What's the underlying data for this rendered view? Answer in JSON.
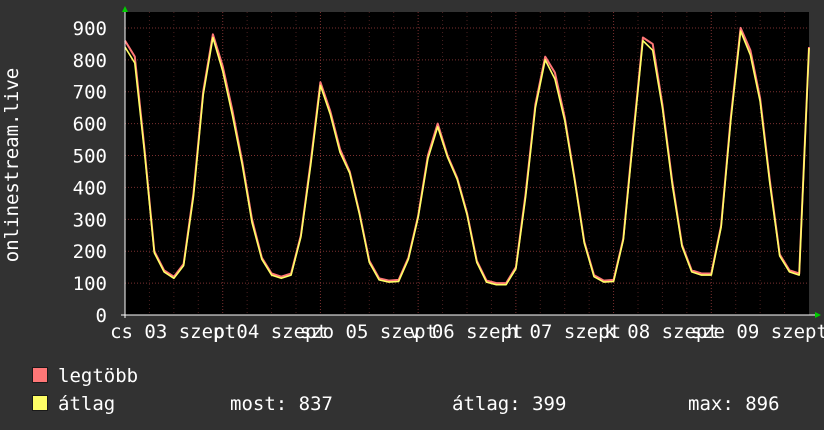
{
  "chart_data": {
    "type": "area",
    "ylabel": "onlinestream.live",
    "ylim": [
      0,
      950
    ],
    "y_ticks": [
      0,
      100,
      200,
      300,
      400,
      500,
      600,
      700,
      800,
      900
    ],
    "x_tick_labels": [
      "cs 03 szept",
      "p 04 szept",
      "szo 05 szept",
      "v 06 szept",
      "h 07 szept",
      "k 08 szept",
      "sze 09 szept"
    ],
    "grid": true,
    "series": [
      {
        "name": "legtöbb",
        "color": "#ff7777",
        "x": [
          0,
          0.1,
          0.2,
          0.3,
          0.4,
          0.5,
          0.6,
          0.7,
          0.8,
          0.9,
          1,
          1.1,
          1.2,
          1.3,
          1.4,
          1.5,
          1.6,
          1.7,
          1.8,
          1.9,
          2,
          2.1,
          2.2,
          2.3,
          2.4,
          2.5,
          2.6,
          2.7,
          2.8,
          2.9,
          3,
          3.1,
          3.2,
          3.3,
          3.4,
          3.5,
          3.6,
          3.7,
          3.8,
          3.9,
          4,
          4.1,
          4.2,
          4.3,
          4.4,
          4.5,
          4.6,
          4.7,
          4.8,
          4.9,
          5,
          5.1,
          5.2,
          5.3,
          5.4,
          5.5,
          5.6,
          5.7,
          5.8,
          5.9,
          6,
          6.1,
          6.2,
          6.3,
          6.4,
          6.5,
          6.6,
          6.7,
          6.8,
          6.9,
          7
        ],
        "values": [
          860,
          810,
          520,
          200,
          140,
          120,
          160,
          380,
          700,
          880,
          780,
          640,
          480,
          300,
          180,
          130,
          120,
          130,
          250,
          480,
          730,
          640,
          520,
          450,
          320,
          170,
          115,
          108,
          110,
          180,
          310,
          500,
          600,
          500,
          430,
          320,
          170,
          108,
          100,
          100,
          150,
          380,
          660,
          810,
          760,
          620,
          430,
          230,
          125,
          108,
          110,
          240,
          560,
          870,
          850,
          660,
          420,
          220,
          140,
          130,
          130,
          280,
          620,
          900,
          830,
          680,
          420,
          190,
          140,
          130,
          840
        ]
      },
      {
        "name": "átlag",
        "color": "#ffff66",
        "x": [
          0,
          0.1,
          0.2,
          0.3,
          0.4,
          0.5,
          0.6,
          0.7,
          0.8,
          0.9,
          1,
          1.1,
          1.2,
          1.3,
          1.4,
          1.5,
          1.6,
          1.7,
          1.8,
          1.9,
          2,
          2.1,
          2.2,
          2.3,
          2.4,
          2.5,
          2.6,
          2.7,
          2.8,
          2.9,
          3,
          3.1,
          3.2,
          3.3,
          3.4,
          3.5,
          3.6,
          3.7,
          3.8,
          3.9,
          4,
          4.1,
          4.2,
          4.3,
          4.4,
          4.5,
          4.6,
          4.7,
          4.8,
          4.9,
          5,
          5.1,
          5.2,
          5.3,
          5.4,
          5.5,
          5.6,
          5.7,
          5.8,
          5.9,
          6,
          6.1,
          6.2,
          6.3,
          6.4,
          6.5,
          6.6,
          6.7,
          6.8,
          6.9,
          7
        ],
        "values": [
          840,
          790,
          510,
          195,
          135,
          115,
          155,
          370,
          690,
          870,
          765,
          625,
          470,
          290,
          175,
          125,
          115,
          125,
          245,
          470,
          720,
          630,
          510,
          445,
          315,
          165,
          110,
          103,
          105,
          175,
          305,
          490,
          590,
          495,
          425,
          315,
          165,
          103,
          95,
          95,
          145,
          370,
          650,
          800,
          740,
          610,
          425,
          225,
          120,
          103,
          105,
          235,
          550,
          860,
          830,
          650,
          410,
          215,
          135,
          125,
          125,
          275,
          610,
          890,
          815,
          670,
          410,
          185,
          135,
          125,
          837
        ]
      }
    ],
    "legend": [
      {
        "label": "legtöbb",
        "color": "#ff7777"
      },
      {
        "label": "átlag",
        "color": "#ffff66"
      }
    ],
    "stats": {
      "most": "most: 837",
      "atlag": "átlag: 399",
      "max": "max: 896"
    }
  }
}
